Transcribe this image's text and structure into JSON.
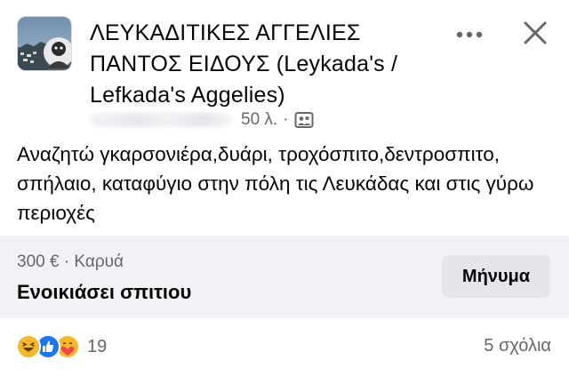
{
  "header": {
    "group_name": "ΛΕΥΚΑΔΙΤΙΚΕΣ ΑΓΓΕΛΙΕΣ ΠΑΝΤΟΣ ΕΙΔΟΥΣ (Leykada's / Lefkada's Aggelies)",
    "time": "50 λ.",
    "separator": "·",
    "icons": [
      "group-avatar",
      "more-horizontal-icon",
      "close-icon",
      "group-post-icon"
    ]
  },
  "post": {
    "text": "Αναζητώ γκαρσονιέρα,δυάρι, τροχόσπιτο,δεντροσπιτο, σπήλαιο, καταφύγιο στην πόλη τις Λευκάδας και στις γύρω περιοχές"
  },
  "listing": {
    "price_location": "300 € · Καρυά",
    "title": "Ενοικιάσει σπιτιου",
    "message_label": "Μήνυμα"
  },
  "footer": {
    "reaction_icons": [
      "haha-icon",
      "like-icon",
      "care-icon"
    ],
    "reaction_count": "19",
    "comments": "5 σχόλια"
  },
  "colors": {
    "text_primary": "#050505",
    "text_secondary": "#65676b",
    "listing_bg": "#f0f2f5",
    "button_bg": "#e4e6eb",
    "like_blue": "#1877f2",
    "haha_yellow": "#f7b928"
  }
}
